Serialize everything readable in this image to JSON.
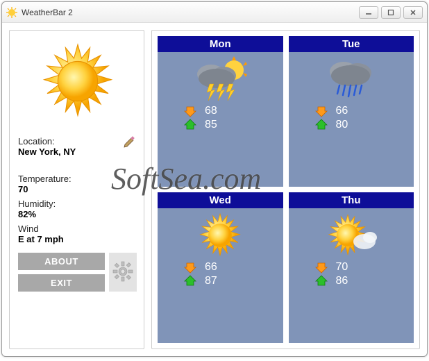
{
  "window": {
    "title": "WeatherBar 2"
  },
  "current": {
    "location_label": "Location:",
    "location_value": "New York, NY",
    "temp_label": "Temperature:",
    "temp_value": "70",
    "humidity_label": "Humidity:",
    "humidity_value": "82%",
    "wind_label": "Wind",
    "wind_value": "E at 7 mph"
  },
  "buttons": {
    "about": "ABOUT",
    "exit": "EXIT"
  },
  "forecast": [
    {
      "day": "Mon",
      "condition": "thunderstorm",
      "low": "68",
      "high": "85"
    },
    {
      "day": "Tue",
      "condition": "rain",
      "low": "66",
      "high": "80"
    },
    {
      "day": "Wed",
      "condition": "sunny",
      "low": "66",
      "high": "87"
    },
    {
      "day": "Thu",
      "condition": "partly-sunny",
      "low": "70",
      "high": "86"
    }
  ],
  "watermark": "SoftSea.com",
  "colors": {
    "card_bg": "#8094b8",
    "header_bg": "#0e0e98",
    "btn_gray": "#a8a8a8"
  }
}
